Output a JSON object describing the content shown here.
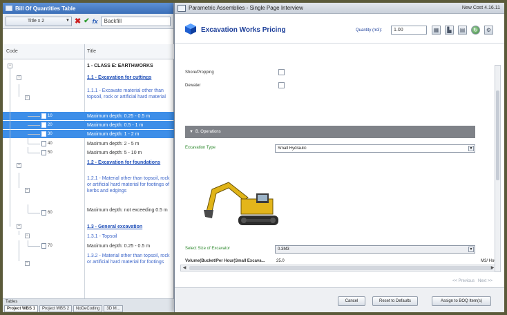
{
  "left_panel": {
    "window_title": "Bill Of Quantities Table",
    "title_selector": "Title x 2",
    "formula_value": "Backfill",
    "columns": {
      "code": "Code",
      "title": "Title"
    },
    "rows": [
      {
        "code": "",
        "title": "1 - CLASS E: EARTHWORKS",
        "style": "bold"
      },
      {
        "code": "",
        "title": "1.1 - Excavation for cuttings",
        "style": "link"
      },
      {
        "code": "",
        "title": "1.1.1 - Excavate material other than topsoil, rock or artificial hard material",
        "style": "desc"
      },
      {
        "code": "10",
        "title": "Maximum depth: 0.25 - 0.5 m",
        "style": "selected"
      },
      {
        "code": "20",
        "title": "Maximum depth: 0.5 - 1 m",
        "style": "selected"
      },
      {
        "code": "30",
        "title": "Maximum depth: 1 - 2 m",
        "style": "selected"
      },
      {
        "code": "40",
        "title": "Maximum depth: 2 - 5 m",
        "style": "plain"
      },
      {
        "code": "50",
        "title": "Maximum depth: 5 - 10 m",
        "style": "plain"
      },
      {
        "code": "",
        "title": "1.2 - Excavation for foundations",
        "style": "link"
      },
      {
        "code": "",
        "title": "1.2.1 - Material other than topsoil, rock or artificial hard material for footings of kerbs and edgings",
        "style": "desc"
      },
      {
        "code": "60",
        "title": "Maximum depth: not exceeding 0.5 m",
        "style": "plain"
      },
      {
        "code": "",
        "title": "1.3 - General excavation",
        "style": "link"
      },
      {
        "code": "",
        "title": "1.3.1 - Topsoil",
        "style": "desc"
      },
      {
        "code": "70",
        "title": "Maximum depth: 0.25 - 0.5 m",
        "style": "plain"
      },
      {
        "code": "",
        "title": "1.3.2 - Material other than topsoil, rock or artificial hard material for footings",
        "style": "desc"
      }
    ],
    "status_label": "Tables",
    "tabs": [
      "Project WBS 1",
      "Project WBS 2",
      "NoDeCoding",
      "3D M..."
    ]
  },
  "dialog": {
    "window_title": "Parametric Assemblies - Single Page Interview",
    "window_right": "New Cost 4.16.11",
    "header": {
      "title": "Excavation Works Pricing",
      "quantity_label": "Quantity (m3):",
      "quantity_value": "1.00"
    },
    "fields": {
      "shoring_label": "Shore/Propping",
      "dewater_label": "Dewater",
      "section_title": "B. Operations",
      "excavation_type_label": "Excavation Type",
      "excavation_type_value": "Small Hydraulic",
      "size_label": "Select Size of Excavator",
      "size_value": "0.3M3",
      "volume_label": "Volume(Bucket/Per Hour(Small Excava...",
      "volume_value": "25.0",
      "volume_unit": "M3/ Hou..."
    },
    "pager": {
      "previous": "<< Previous",
      "next": "Next >>"
    },
    "buttons": {
      "cancel": "Cancel",
      "reset": "Reset to Defaults",
      "assign": "Assign to BOQ Item(s)"
    }
  }
}
